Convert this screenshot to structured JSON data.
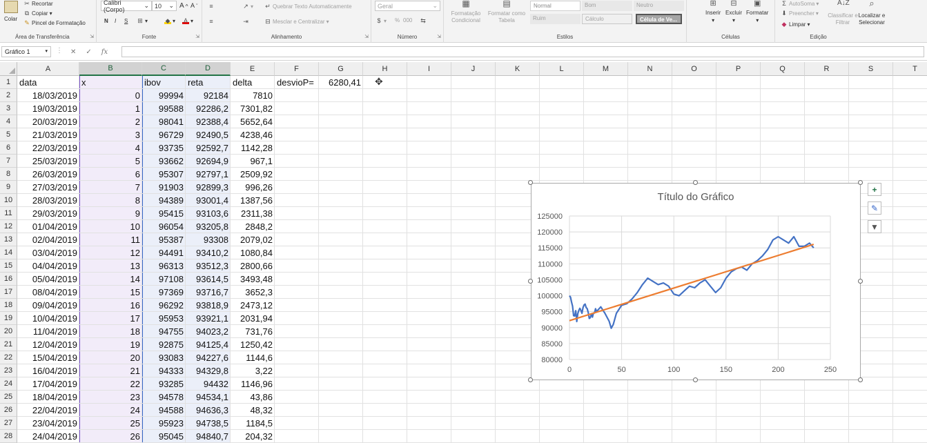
{
  "ribbon": {
    "clipboard": {
      "paste": "Colar",
      "cut": "Recortar",
      "copy": "Copiar",
      "format_painter": "Pincel de Formatação",
      "title": "Área de Transferência"
    },
    "font": {
      "name": "Calibri (Corpo)",
      "size": "10",
      "bold": "N",
      "italic": "I",
      "underline": "S",
      "title": "Fonte"
    },
    "alignment": {
      "wrap": "Quebrar Texto Automaticamente",
      "merge": "Mesclar e Centralizar",
      "title": "Alinhamento"
    },
    "number": {
      "format": "Geral",
      "percent": "%",
      "thousands": "000",
      "title": "Número"
    },
    "styles": {
      "conditional": "Formatação Condicional",
      "as_table": "Formatar como Tabela",
      "normal": "Normal",
      "good": "Bom",
      "neutral": "Neutro",
      "bad": "Ruim",
      "calc": "Cálculo",
      "check": "Célula de Ve...",
      "title": "Estilos"
    },
    "cells": {
      "insert": "Inserir",
      "delete": "Excluir",
      "format": "Formatar",
      "title": "Células"
    },
    "editing": {
      "autosum": "AutoSoma",
      "fill": "Preencher",
      "clear": "Limpar",
      "sort": "Classificar e Filtrar",
      "find": "Localizar e Selecionar",
      "title": "Edição"
    }
  },
  "formula_bar": {
    "name_box": "Gráfico 1",
    "fx": "fx"
  },
  "columns": [
    "A",
    "B",
    "C",
    "D",
    "E",
    "F",
    "G",
    "H",
    "I",
    "J",
    "K",
    "L",
    "M",
    "N",
    "O",
    "P",
    "Q",
    "R",
    "S",
    "T"
  ],
  "header_row": {
    "a": "data",
    "b": "x",
    "c": "ibov",
    "d": "reta",
    "e": "delta",
    "f": "desvioP=",
    "g": "6280,41"
  },
  "rows": [
    [
      "18/03/2019",
      "0",
      "99994",
      "92184",
      "7810"
    ],
    [
      "19/03/2019",
      "1",
      "99588",
      "92286,2",
      "7301,82"
    ],
    [
      "20/03/2019",
      "2",
      "98041",
      "92388,4",
      "5652,64"
    ],
    [
      "21/03/2019",
      "3",
      "96729",
      "92490,5",
      "4238,46"
    ],
    [
      "22/03/2019",
      "4",
      "93735",
      "92592,7",
      "1142,28"
    ],
    [
      "25/03/2019",
      "5",
      "93662",
      "92694,9",
      "967,1"
    ],
    [
      "26/03/2019",
      "6",
      "95307",
      "92797,1",
      "2509,92"
    ],
    [
      "27/03/2019",
      "7",
      "91903",
      "92899,3",
      "996,26"
    ],
    [
      "28/03/2019",
      "8",
      "94389",
      "93001,4",
      "1387,56"
    ],
    [
      "29/03/2019",
      "9",
      "95415",
      "93103,6",
      "2311,38"
    ],
    [
      "01/04/2019",
      "10",
      "96054",
      "93205,8",
      "2848,2"
    ],
    [
      "02/04/2019",
      "11",
      "95387",
      "93308",
      "2079,02"
    ],
    [
      "03/04/2019",
      "12",
      "94491",
      "93410,2",
      "1080,84"
    ],
    [
      "04/04/2019",
      "13",
      "96313",
      "93512,3",
      "2800,66"
    ],
    [
      "05/04/2019",
      "14",
      "97108",
      "93614,5",
      "3493,48"
    ],
    [
      "08/04/2019",
      "15",
      "97369",
      "93716,7",
      "3652,3"
    ],
    [
      "09/04/2019",
      "16",
      "96292",
      "93818,9",
      "2473,12"
    ],
    [
      "10/04/2019",
      "17",
      "95953",
      "93921,1",
      "2031,94"
    ],
    [
      "11/04/2019",
      "18",
      "94755",
      "94023,2",
      "731,76"
    ],
    [
      "12/04/2019",
      "19",
      "92875",
      "94125,4",
      "1250,42"
    ],
    [
      "15/04/2019",
      "20",
      "93083",
      "94227,6",
      "1144,6"
    ],
    [
      "16/04/2019",
      "21",
      "94333",
      "94329,8",
      "3,22"
    ],
    [
      "17/04/2019",
      "22",
      "93285",
      "94432",
      "1146,96"
    ],
    [
      "18/04/2019",
      "23",
      "94578",
      "94534,1",
      "43,86"
    ],
    [
      "22/04/2019",
      "24",
      "94588",
      "94636,3",
      "48,32"
    ],
    [
      "23/04/2019",
      "25",
      "95923",
      "94738,5",
      "1184,5"
    ],
    [
      "24/04/2019",
      "26",
      "95045",
      "94840,7",
      "204,32"
    ]
  ],
  "chart_data": {
    "type": "line",
    "title": "Título do Gráfico",
    "xlim": [
      0,
      250
    ],
    "ylim": [
      80000,
      125000
    ],
    "x_ticks": [
      0,
      50,
      100,
      150,
      200,
      250
    ],
    "y_ticks": [
      80000,
      85000,
      90000,
      95000,
      100000,
      105000,
      110000,
      115000,
      120000,
      125000
    ],
    "grid": true,
    "series": [
      {
        "color": "#4472c4",
        "x": [
          0,
          1,
          2,
          3,
          4,
          5,
          6,
          7,
          8,
          9,
          10,
          11,
          12,
          13,
          14,
          15,
          16,
          17,
          18,
          19,
          20,
          21,
          22,
          23,
          24,
          25,
          26,
          30,
          34,
          38,
          40,
          42,
          45,
          50,
          55,
          60,
          65,
          70,
          75,
          80,
          85,
          90,
          95,
          100,
          105,
          110,
          115,
          120,
          125,
          130,
          135,
          140,
          145,
          150,
          155,
          160,
          165,
          170,
          175,
          180,
          185,
          190,
          195,
          200,
          205,
          210,
          215,
          220,
          225,
          230,
          234
        ],
        "y": [
          99994,
          99588,
          98041,
          96729,
          93735,
          93662,
          95307,
          91903,
          94389,
          95415,
          96054,
          95387,
          94491,
          96313,
          97108,
          97369,
          96292,
          95953,
          94755,
          92875,
          93083,
          94333,
          93285,
          94578,
          94588,
          95923,
          95045,
          96500,
          94500,
          92000,
          89800,
          91000,
          94500,
          97000,
          97500,
          99000,
          101000,
          103500,
          105500,
          104500,
          103500,
          104000,
          103000,
          100500,
          100000,
          101500,
          103000,
          102500,
          104000,
          105000,
          103000,
          101000,
          102500,
          105500,
          107500,
          108500,
          109000,
          108000,
          110000,
          111000,
          112500,
          114500,
          117500,
          118500,
          117500,
          116500,
          118500,
          115500,
          115500,
          116500,
          115000
        ]
      },
      {
        "color": "#ed7d31",
        "x": [
          0,
          234
        ],
        "y": [
          92184,
          116100
        ]
      }
    ]
  }
}
